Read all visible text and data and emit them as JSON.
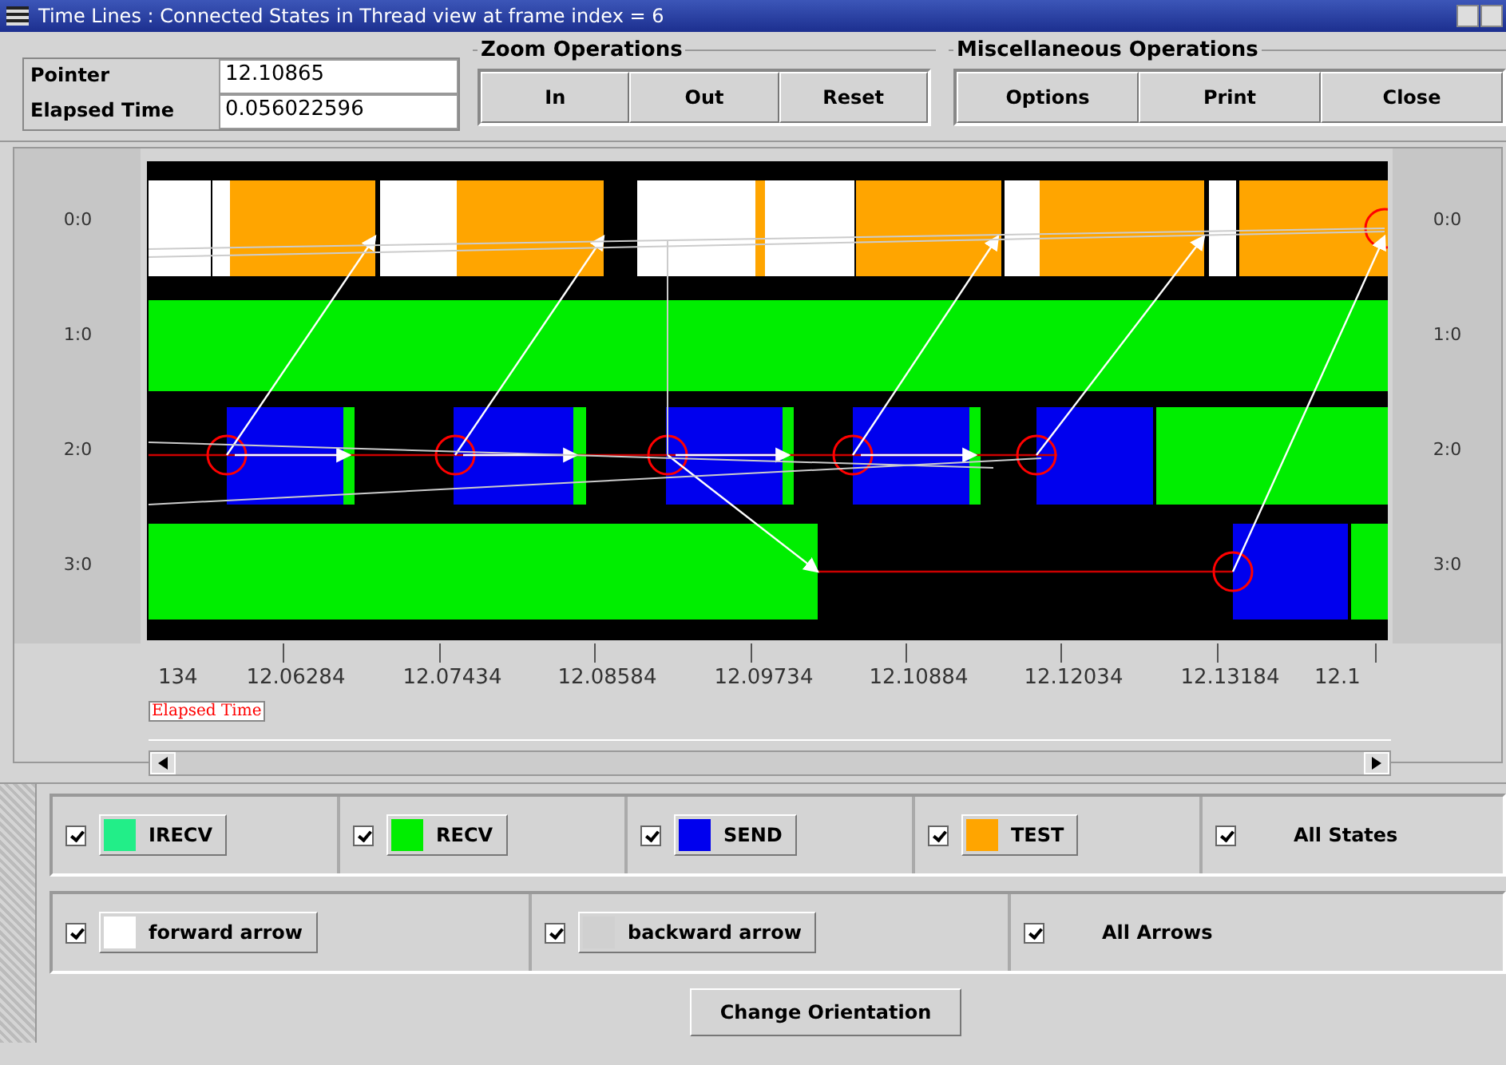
{
  "window": {
    "title": "Time Lines : Connected States in Thread view at frame index = 6"
  },
  "readouts": [
    {
      "label": "Pointer",
      "value": "12.10865"
    },
    {
      "label": "Elapsed Time",
      "value": "0.056022596"
    }
  ],
  "groups": [
    {
      "title": "Zoom Operations",
      "buttons": [
        "In",
        "Out",
        "Reset"
      ]
    },
    {
      "title": "Miscellaneous Operations",
      "buttons": [
        "Options",
        "Print",
        "Close"
      ]
    }
  ],
  "timeline": {
    "rows_left": [
      "0:0",
      "1:0",
      "2:0",
      "3:0"
    ],
    "rows_right": [
      "0:0",
      "1:0",
      "2:0",
      "3:0"
    ],
    "ticks": [
      "134",
      "12.06284",
      "12.07434",
      "12.08584",
      "12.09734",
      "12.10884",
      "12.12034",
      "12.13184",
      "12.1"
    ],
    "axis_label": "Elapsed Time"
  },
  "states": [
    {
      "label": "IRECV",
      "color": "#22ee88",
      "checked": true
    },
    {
      "label": "RECV",
      "color": "#00ee00",
      "checked": true
    },
    {
      "label": "SEND",
      "color": "#0000ee",
      "checked": true
    },
    {
      "label": "TEST",
      "color": "#ffa500",
      "checked": true
    }
  ],
  "all_states": {
    "label": "All States",
    "checked": true
  },
  "arrows": [
    {
      "label": "forward arrow",
      "color": "#ffffff",
      "checked": true
    },
    {
      "label": "backward arrow",
      "color": "#d0d0d0",
      "checked": true
    }
  ],
  "all_arrows": {
    "label": "All Arrows",
    "checked": true
  },
  "footer_button": "Change Orientation"
}
